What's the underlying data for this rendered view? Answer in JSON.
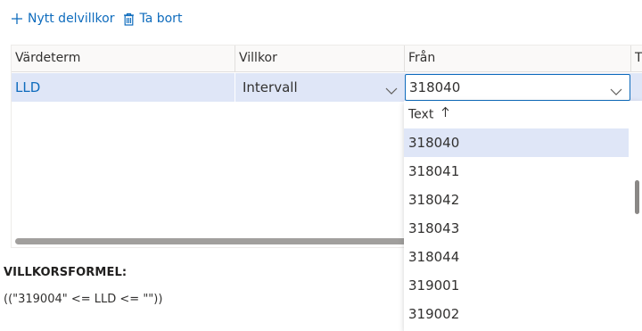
{
  "toolbar": {
    "new_label": "Nytt delvillkor",
    "delete_label": "Ta bort",
    "new_icon": "plus-icon",
    "delete_icon": "trash-icon",
    "accent": "#0f6cbd"
  },
  "grid": {
    "columns": [
      "Värdeterm",
      "Villkor",
      "Från",
      "T"
    ],
    "rows": [
      {
        "term": "LLD",
        "villkor": "Intervall",
        "fran": "318040"
      }
    ],
    "selected_row_color": "#dfe6f7"
  },
  "formula": {
    "label": "VILLKORSFORMEL:",
    "value": "((\"319004\" <= LLD <= \"\"))"
  },
  "dropdown": {
    "header": "Text",
    "sort_icon": "arrow-up-icon",
    "items": [
      "318040",
      "318041",
      "318042",
      "318043",
      "318044",
      "319001",
      "319002"
    ],
    "selected": "318040"
  }
}
